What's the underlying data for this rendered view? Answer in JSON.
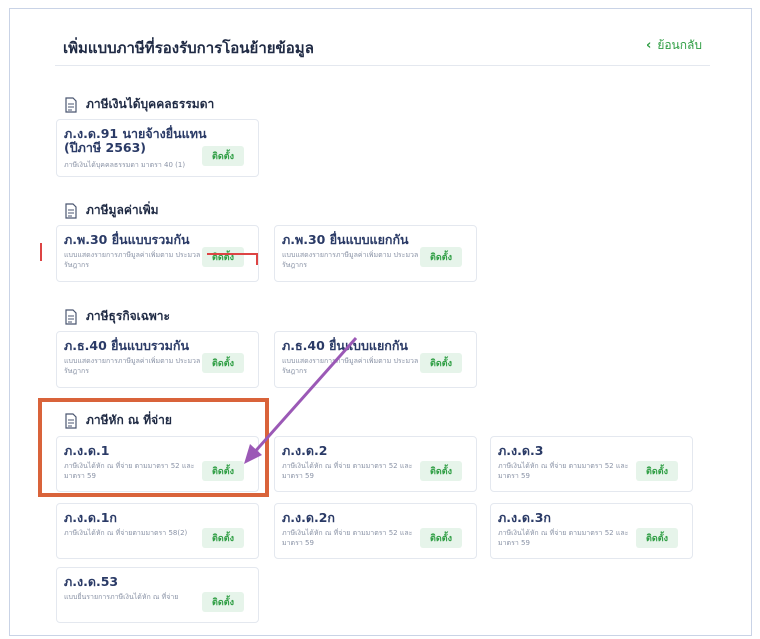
{
  "header": {
    "title": "เพิ่มแบบภาษีที่รองรับการโอนย้ายข้อมูล",
    "back_label": "ย้อนกลับ"
  },
  "install_label": "ติดตั้ง",
  "sections": [
    {
      "title": "ภาษีเงินได้บุคคลธรรมดา"
    },
    {
      "title": "ภาษีมูลค่าเพิ่ม"
    },
    {
      "title": "ภาษีธุรกิจเฉพาะ"
    },
    {
      "title": "ภาษีหัก ณ ที่จ่าย"
    }
  ],
  "cards": {
    "pnd91": {
      "title": "ภ.ง.ด.91 นายจ้างยื่นแทน (ปีภาษี 2563)",
      "desc": "ภาษีเงินได้บุคคลธรรมดา มาตรา 40 (1)"
    },
    "pp30a": {
      "title": "ภ.พ.30 ยื่นแบบรวมกัน",
      "desc": "แบบแสดงรายการภาษีมูลค่าเพิ่มตาม ประมวลรัษฎากร"
    },
    "pp30b": {
      "title": "ภ.พ.30 ยื่นแบบแยกกัน",
      "desc": "แบบแสดงรายการภาษีมูลค่าเพิ่มตาม ประมวลรัษฎากร"
    },
    "pt40a": {
      "title": "ภ.ธ.40 ยื่นแบบรวมกัน",
      "desc": "แบบแสดงรายการภาษีมูลค่าเพิ่มตาม ประมวลรัษฎากร"
    },
    "pt40b": {
      "title": "ภ.ธ.40 ยื่นแบบแยกกัน",
      "desc": "แบบแสดงรายการภาษีมูลค่าเพิ่มตาม ประมวลรัษฎากร"
    },
    "pnd1": {
      "title": "ภ.ง.ด.1",
      "desc": "ภาษีเงินได้หัก ณ ที่จ่าย ตามมาตรา 52 และมาตรา 59"
    },
    "pnd2": {
      "title": "ภ.ง.ด.2",
      "desc": "ภาษีเงินได้หัก ณ ที่จ่าย ตามมาตรา 52 และมาตรา 59"
    },
    "pnd3": {
      "title": "ภ.ง.ด.3",
      "desc": "ภาษีเงินได้หัก ณ ที่จ่าย ตามมาตรา 52 และมาตรา 59"
    },
    "pnd1k": {
      "title": "ภ.ง.ด.1ก",
      "desc": "ภาษีเงินได้หัก ณ ที่จ่ายตามมาตรา 58(2)"
    },
    "pnd2k": {
      "title": "ภ.ง.ด.2ก",
      "desc": "ภาษีเงินได้หัก ณ ที่จ่าย ตามมาตรา 52 และมาตรา 59"
    },
    "pnd3k": {
      "title": "ภ.ง.ด.3ก",
      "desc": "ภาษีเงินได้หัก ณ ที่จ่าย ตามมาตรา 52 และมาตรา 59"
    },
    "pnd53": {
      "title": "ภ.ง.ด.53",
      "desc": "แบบยื่นรายการภาษีเงินได้หัก ณ ที่จ่าย"
    }
  },
  "colors": {
    "accent": "#2f9e44",
    "highlight_box": "#d9633a",
    "arrow": "#9b59b6"
  }
}
